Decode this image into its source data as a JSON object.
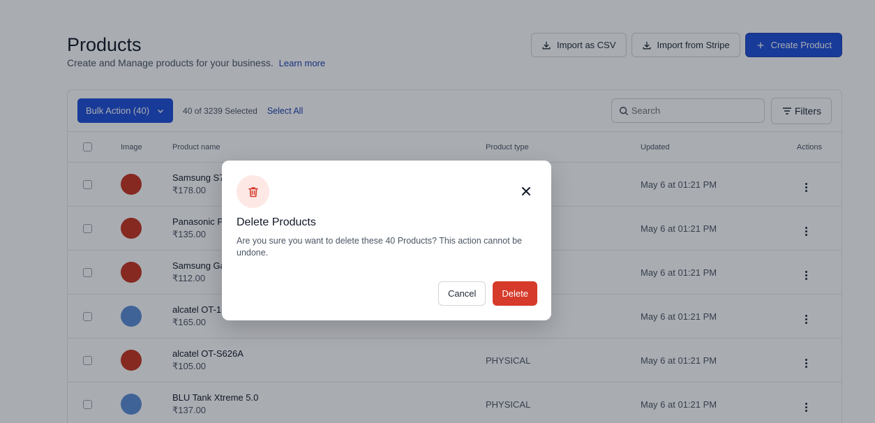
{
  "header": {
    "title": "Products",
    "subtitle": "Create and Manage products for your business.",
    "learn_more": "Learn more",
    "import_csv": "Import as CSV",
    "import_stripe": "Import from Stripe",
    "create_product": "Create Product"
  },
  "toolbar": {
    "bulk_action": "Bulk Action (40)",
    "selected_count": "40 of 3239 Selected",
    "select_all": "Select All",
    "search_placeholder": "Search",
    "filters": "Filters"
  },
  "table": {
    "columns": {
      "image": "Image",
      "name": "Product name",
      "type": "Product type",
      "updated": "Updated",
      "actions": "Actions"
    },
    "rows": [
      {
        "name": "Samsung S7",
        "price": "₹178.00",
        "type": "",
        "updated": "May 6 at 01:21 PM",
        "thumb_color": "red"
      },
      {
        "name": "Panasonic P",
        "price": "₹135.00",
        "type": "",
        "updated": "May 6 at 01:21 PM",
        "thumb_color": "red"
      },
      {
        "name": "Samsung Ga",
        "price": "₹112.00",
        "type": "",
        "updated": "May 6 at 01:21 PM",
        "thumb_color": "red"
      },
      {
        "name": "alcatel OT-1",
        "price": "₹165.00",
        "type": "",
        "updated": "May 6 at 01:21 PM",
        "thumb_color": "blue"
      },
      {
        "name": "alcatel OT-S626A",
        "price": "₹105.00",
        "type": "PHYSICAL",
        "updated": "May 6 at 01:21 PM",
        "thumb_color": "red"
      },
      {
        "name": "BLU Tank Xtreme 5.0",
        "price": "₹137.00",
        "type": "PHYSICAL",
        "updated": "May 6 at 01:21 PM",
        "thumb_color": "blue"
      }
    ]
  },
  "modal": {
    "title": "Delete Products",
    "message": "Are you sure you want to delete these 40 Products? This action cannot be undone.",
    "cancel": "Cancel",
    "delete": "Delete"
  },
  "colors": {
    "primary": "#1d4ed8",
    "danger": "#d53a2b",
    "danger_soft": "#fde8e6"
  }
}
